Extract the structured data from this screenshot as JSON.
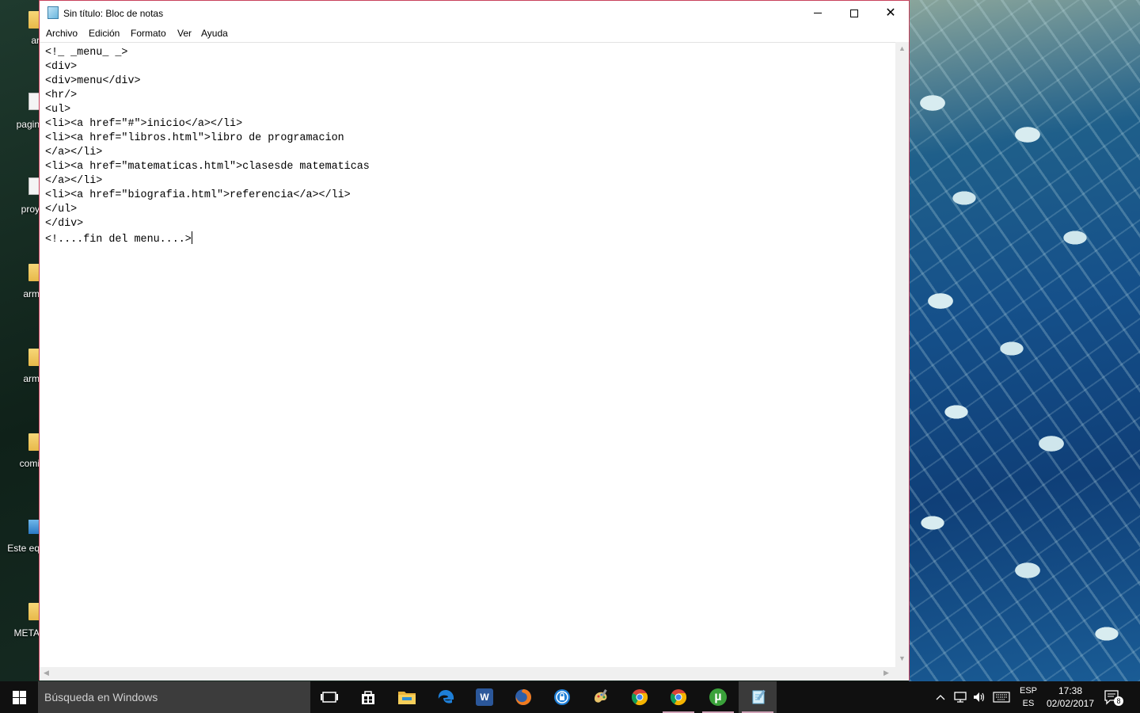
{
  "window": {
    "title": "Sin título: Bloc de notas"
  },
  "menu": {
    "items": [
      "Archivo",
      "Edición",
      "Formato",
      "Ver",
      "Ayuda"
    ]
  },
  "editor": {
    "lines": [
      "<!_ _menu_ _>",
      "<div>",
      "<div>menu</div>",
      "<hr/>",
      "<ul>",
      "<li><a href=\"#\">inicio</a></li>",
      "<li><a href=\"libros.html\">libro de programacion",
      "</a></li>",
      "<li><a href=\"matematicas.html\">clasesde matematicas",
      "</a></li>",
      "<li><a href=\"biografia.html\">referencia</a></li>",
      "</ul>",
      "</div>",
      "<!....fin del menu....>"
    ]
  },
  "desktop": {
    "icons": [
      {
        "label": "ar",
        "kind": "folder-icon"
      },
      {
        "label": "pagin",
        "kind": "document-icon"
      },
      {
        "label": "proy",
        "kind": "document-icon"
      },
      {
        "label": "arm",
        "kind": "folder-icon"
      },
      {
        "label": "arm",
        "kind": "folder-icon"
      },
      {
        "label": "comi",
        "kind": "folder-icon"
      },
      {
        "label": "Este eq",
        "kind": "computer-icon"
      },
      {
        "label": "META",
        "kind": "folder-icon"
      }
    ]
  },
  "taskbar": {
    "search_placeholder": "Búsqueda en Windows",
    "apps": [
      "task-view-icon",
      "store-icon",
      "file-explorer-icon",
      "edge-icon",
      "word-icon",
      "firefox-icon",
      "security-icon",
      "paint-icon",
      "chrome-icon",
      "chrome-icon",
      "utorrent-icon",
      "notepad-icon"
    ],
    "word_letter": "W",
    "utorrent_letter": "µ",
    "language_top": "ESP",
    "language_bottom": "ES",
    "time": "17:38",
    "date": "02/02/2017",
    "notification_count": "8"
  },
  "colors": {
    "window_border": "#c8415c",
    "taskbar": "#101010",
    "search_box": "#3c3c3c"
  }
}
